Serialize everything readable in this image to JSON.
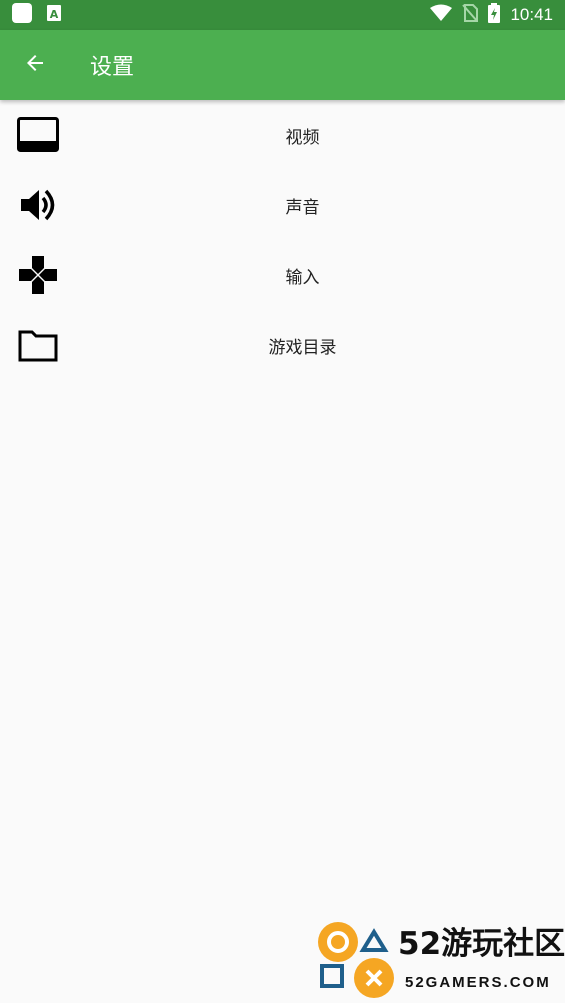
{
  "status_bar": {
    "time": "10:41"
  },
  "app_bar": {
    "title": "设置"
  },
  "settings": {
    "items": [
      {
        "label": "视频",
        "icon": "video-icon"
      },
      {
        "label": "声音",
        "icon": "volume-icon"
      },
      {
        "label": "输入",
        "icon": "gamepad-icon"
      },
      {
        "label": "游戏目录",
        "icon": "folder-icon"
      }
    ]
  },
  "watermark": {
    "title": "52游玩社区",
    "subtitle": "52GAMERS.COM"
  },
  "colors": {
    "status_bar": "#388e3c",
    "app_bar": "#4caf50",
    "background": "#fafafa",
    "watermark_orange": "#f5a623",
    "watermark_blue": "#1f5f8b"
  }
}
